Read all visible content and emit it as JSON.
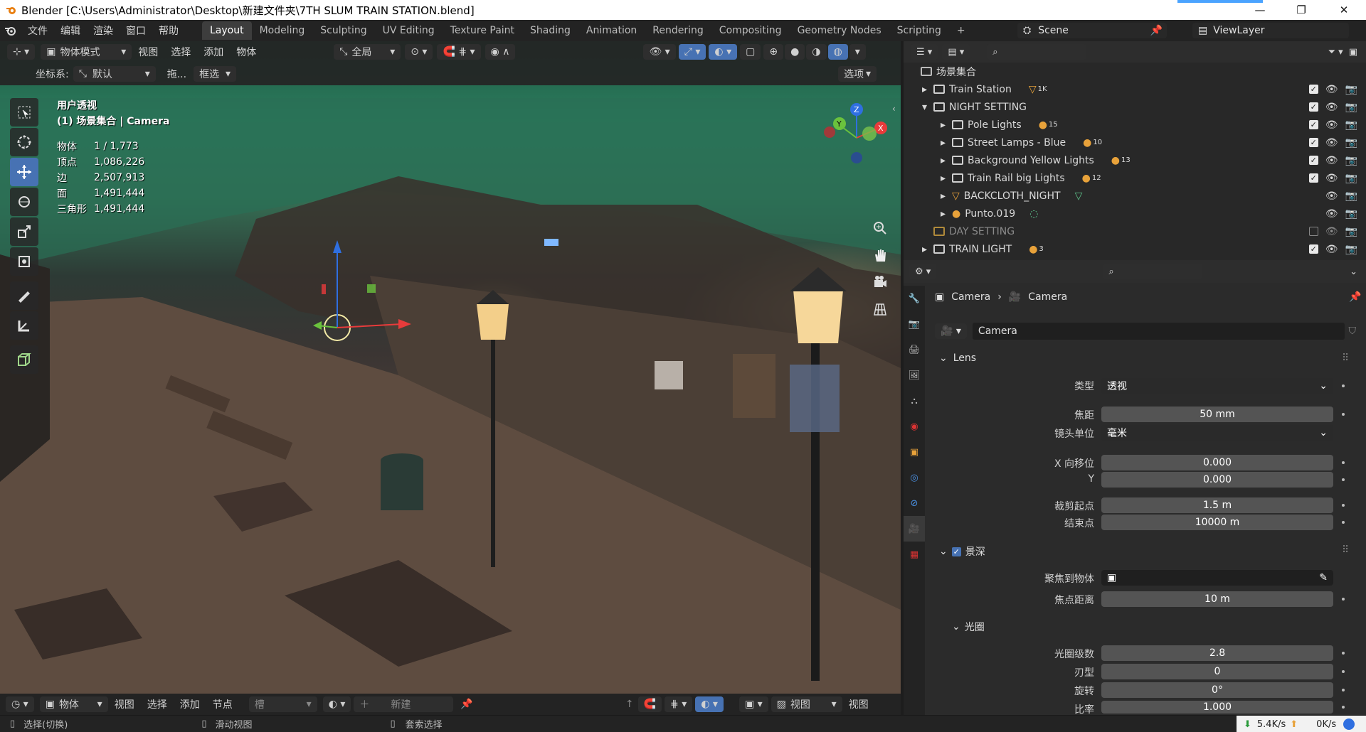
{
  "titlebar": {
    "title": "Blender [C:\\Users\\Administrator\\Desktop\\新建文件夹\\7TH SLUM TRAIN STATION.blend]",
    "minimize": "—",
    "restore": "❐",
    "close": "✕"
  },
  "menubar": {
    "menus": [
      "文件",
      "编辑",
      "渲染",
      "窗口",
      "帮助"
    ],
    "workspaces": [
      "Layout",
      "Modeling",
      "Sculpting",
      "UV Editing",
      "Texture Paint",
      "Shading",
      "Animation",
      "Rendering",
      "Compositing",
      "Geometry Nodes",
      "Scripting"
    ],
    "add_tab": "+",
    "scene": "Scene",
    "view_layer": "ViewLayer"
  },
  "viewport": {
    "mode": "物体模式",
    "menus": [
      "视图",
      "选择",
      "添加",
      "物体"
    ],
    "transform_orientation": "全局",
    "coord_label": "坐标系:",
    "coord_value": "默认",
    "drag_label": "拖...",
    "select_mode": "框选",
    "options": "选项",
    "view_name": "用户透视",
    "collection_info": "(1) 场景集合 | Camera",
    "stats": [
      {
        "label": "物体",
        "value": "1 / 1,773"
      },
      {
        "label": "顶点",
        "value": "1,086,226"
      },
      {
        "label": "边",
        "value": "2,507,913"
      },
      {
        "label": "面",
        "value": "1,491,444"
      },
      {
        "label": "三角形",
        "value": "1,491,444"
      }
    ],
    "gizmo_axes": {
      "z": "Z",
      "y": "Y",
      "x": "X"
    }
  },
  "timeline": {
    "mode": "物体",
    "menus": [
      "视图",
      "选择",
      "添加",
      "节点"
    ],
    "slot": "槽",
    "new": "新建",
    "view": "视图",
    "view2": "视图"
  },
  "statusbar": {
    "select": "选择(切换)",
    "pan": "滑动视图",
    "lasso": "套索选择",
    "down_speed": "5.4K/s",
    "up_speed": "0K/s"
  },
  "outliner": {
    "root": "场景集合",
    "items": [
      {
        "name": "Train Station",
        "badge": "1K",
        "depth": 1,
        "expand": "▸",
        "checked": true
      },
      {
        "name": "NIGHT SETTING",
        "badge": "",
        "depth": 1,
        "expand": "▾",
        "checked": true
      },
      {
        "name": "Pole Lights",
        "badge": "15",
        "depth": 2,
        "expand": "▸",
        "checked": true
      },
      {
        "name": "Street Lamps - Blue",
        "badge": "10",
        "depth": 2,
        "expand": "▸",
        "checked": true
      },
      {
        "name": "Background Yellow Lights",
        "badge": "13",
        "depth": 2,
        "expand": "▸",
        "checked": true
      },
      {
        "name": "Train Rail big Lights",
        "badge": "12",
        "depth": 2,
        "expand": "▸",
        "checked": true
      },
      {
        "name": "BACKCLOTH_NIGHT",
        "badge": "",
        "depth": 2,
        "expand": "▸",
        "checked": null
      },
      {
        "name": "Punto.019",
        "badge": "",
        "depth": 2,
        "expand": "▸",
        "checked": null
      },
      {
        "name": "DAY SETTING",
        "badge": "",
        "depth": 1,
        "expand": "",
        "checked": false
      },
      {
        "name": "TRAIN LIGHT",
        "badge": "3",
        "depth": 1,
        "expand": "▸",
        "checked": true
      }
    ]
  },
  "properties": {
    "breadcrumb_object": "Camera",
    "breadcrumb_data": "Camera",
    "datablock": "Camera",
    "lens_section": "Lens",
    "fields": {
      "type_label": "类型",
      "type_value": "透视",
      "focal_label": "焦距",
      "focal_value": "50 mm",
      "unit_label": "镜头单位",
      "unit_value": "毫米",
      "shiftx_label": "X 向移位",
      "shiftx_value": "0.000",
      "shifty_label": "Y",
      "shifty_value": "0.000",
      "clip_start_label": "裁剪起点",
      "clip_start_value": "1.5 m",
      "clip_end_label": "结束点",
      "clip_end_value": "10000 m"
    },
    "dof_section": "景深",
    "dof": {
      "focus_object_label": "聚焦到物体",
      "focus_distance_label": "焦点距离",
      "focus_distance_value": "10 m"
    },
    "aperture_section": "光圈",
    "aperture": {
      "fstop_label": "光圈级数",
      "fstop_value": "2.8",
      "blades_label": "刃型",
      "blades_value": "0",
      "rotation_label": "旋转",
      "rotation_value": "0°",
      "ratio_label": "比率",
      "ratio_value": "1.000"
    }
  },
  "colors": {
    "accent": "#4772b3",
    "panel": "#2b2b2b",
    "field": "#545454"
  }
}
